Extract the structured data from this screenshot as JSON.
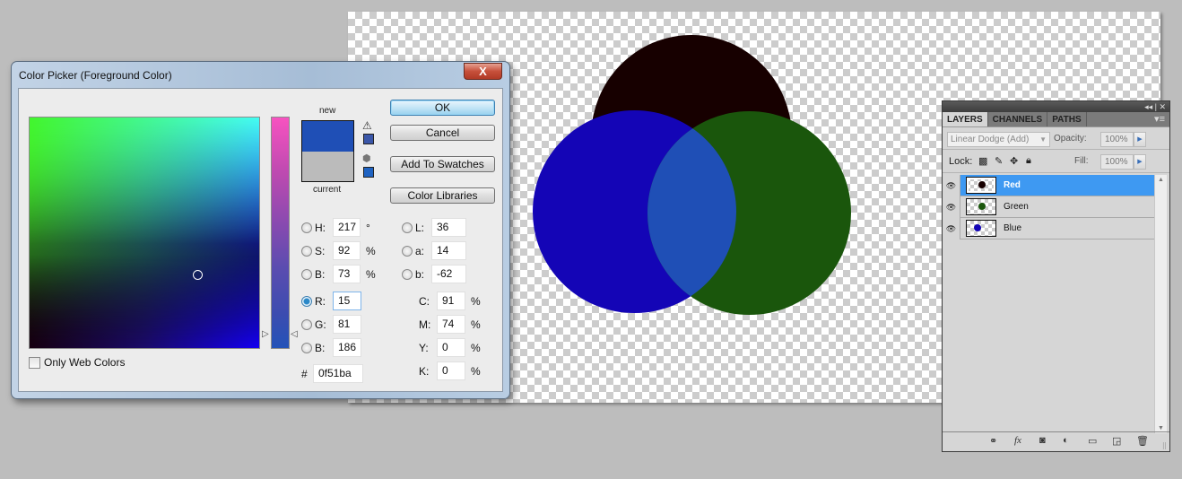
{
  "canvas": {
    "layers_visual": [
      {
        "name": "Red",
        "color": "#170000"
      },
      {
        "name": "Blue",
        "color": "#1405b6"
      },
      {
        "name": "Green",
        "color": "#1a560c"
      }
    ],
    "overlap_color": "#1f4fb6"
  },
  "color_picker": {
    "title": "Color Picker (Foreground Color)",
    "close_label": "X",
    "new_label": "new",
    "current_label": "current",
    "new_color": "#1f4fb6",
    "current_color": "#bbbbbb",
    "gamut_warning_color": "#3a56a8",
    "web_safe_color": "#1f63c2",
    "buttons": {
      "ok": "OK",
      "cancel": "Cancel",
      "add_to_swatches": "Add To Swatches",
      "color_libraries": "Color Libraries"
    },
    "only_web_colors": {
      "label": "Only Web Colors",
      "checked": false
    },
    "hsb": [
      {
        "label": "H:",
        "value": "217",
        "unit": "°",
        "selected": false
      },
      {
        "label": "S:",
        "value": "92",
        "unit": "%",
        "selected": false
      },
      {
        "label": "B:",
        "value": "73",
        "unit": "%",
        "selected": false
      }
    ],
    "rgb": [
      {
        "label": "R:",
        "value": "15",
        "selected": true
      },
      {
        "label": "G:",
        "value": "81",
        "selected": false
      },
      {
        "label": "B:",
        "value": "186",
        "selected": false
      }
    ],
    "lab": [
      {
        "label": "L:",
        "value": "36"
      },
      {
        "label": "a:",
        "value": "14"
      },
      {
        "label": "b:",
        "value": "-62"
      }
    ],
    "cmyk": [
      {
        "label": "C:",
        "value": "91",
        "unit": "%"
      },
      {
        "label": "M:",
        "value": "74",
        "unit": "%"
      },
      {
        "label": "Y:",
        "value": "0",
        "unit": "%"
      },
      {
        "label": "K:",
        "value": "0",
        "unit": "%"
      }
    ],
    "hex_label": "#",
    "hex_value": "0f51ba"
  },
  "layers_panel": {
    "collapse_label": "◂◂ | ✕",
    "tabs": [
      "LAYERS",
      "CHANNELS",
      "PATHS"
    ],
    "active_tab": "LAYERS",
    "menu_icon": "▾≡",
    "blend_mode": "Linear Dodge (Add)",
    "opacity_label": "Opacity:",
    "opacity_value": "100%",
    "lock_label": "Lock:",
    "fill_label": "Fill:",
    "fill_value": "100%",
    "layers": [
      {
        "name": "Red",
        "thumb_color": "#170000",
        "selected": true,
        "visible": true
      },
      {
        "name": "Green",
        "thumb_color": "#1a560c",
        "selected": false,
        "visible": true
      },
      {
        "name": "Blue",
        "thumb_color": "#1405b6",
        "selected": false,
        "visible": true
      }
    ]
  }
}
